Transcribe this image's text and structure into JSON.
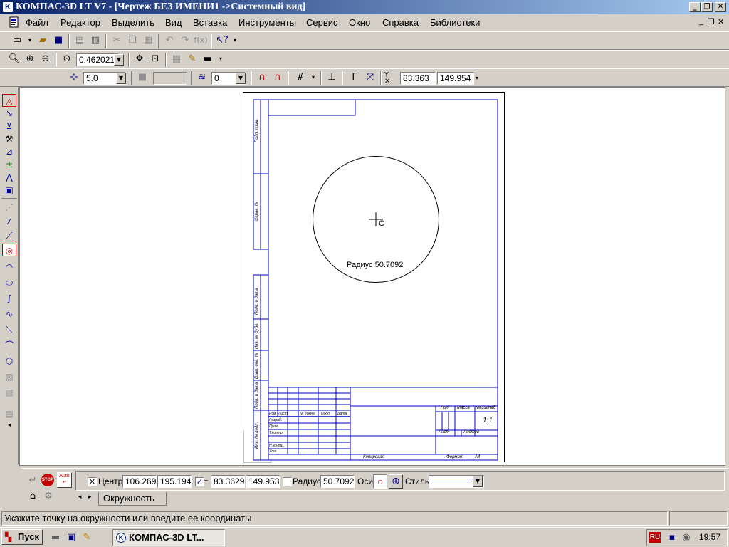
{
  "window": {
    "title": "КОМПАС-3D LT V7 - [Чертеж БЕЗ ИМЕНИ1 ->Системный вид]",
    "app_icon_letter": "K",
    "minimize": "_",
    "restore": "❐",
    "close": "✕"
  },
  "menu": {
    "items": [
      "Файл",
      "Редактор",
      "Выделить",
      "Вид",
      "Вставка",
      "Инструменты",
      "Сервис",
      "Окно",
      "Справка",
      "Библиотеки"
    ],
    "doc_minimize": "_",
    "doc_restore": "❐",
    "doc_close": "✕"
  },
  "toolbar_view": {
    "zoom_value": "0.462021"
  },
  "toolbar_current": {
    "step_value": "5.0",
    "layer_value": "0",
    "coord_x": "83.363",
    "coord_y": "149.954",
    "coord_label": "Y"
  },
  "drawing": {
    "radius_label": "Радиус 50.7092",
    "center_marker_label": "C",
    "frame_labels": [
      "Подп. прим.",
      "Справ. №",
      "Подп. и дата",
      "Инв. № дубл.",
      "Взам. инв. №",
      "Подп. и дата",
      "Инв. № подл."
    ],
    "title_block": {
      "lit": "Лит",
      "mass": "Масса",
      "scale": "Масштаб",
      "scale_value": "1:1",
      "sheet": "Лист",
      "sheets": "Листов",
      "izm": "Изм",
      "list": "Лист",
      "doc_no": "№ докум.",
      "podp": "Подп.",
      "date": "Дата",
      "razrab": "Разраб.",
      "prov": "Пров.",
      "tkontr": "Т.контр.",
      "nkontr": "Н.контр.",
      "utv": "Утв.",
      "copied": "Копировал",
      "format": "Формат",
      "format_value": "A4"
    }
  },
  "panel": {
    "stop_label": "STOP",
    "auto_label": "Auto",
    "center_label": "Центр",
    "center_x": "106.269",
    "center_y": "195.194",
    "point_label": "т",
    "point_x": "83.3629",
    "point_y": "149.953",
    "radius_label": "Радиус",
    "radius_value": "50.7092",
    "axes_label": "Оси",
    "style_label": "Стиль",
    "tab_label": "Окружность"
  },
  "status": {
    "hint": "Укажите точку на окружности или введите ее координаты"
  },
  "taskbar": {
    "start_label": "Пуск",
    "task_label": "КОМПАС-3D LT...",
    "lang": "RU",
    "clock": "19:57"
  },
  "colors": {
    "title_start": "#0a246a",
    "title_end": "#a6caf0",
    "frame_blue": "#0000c0",
    "face": "#d4d0c8"
  }
}
